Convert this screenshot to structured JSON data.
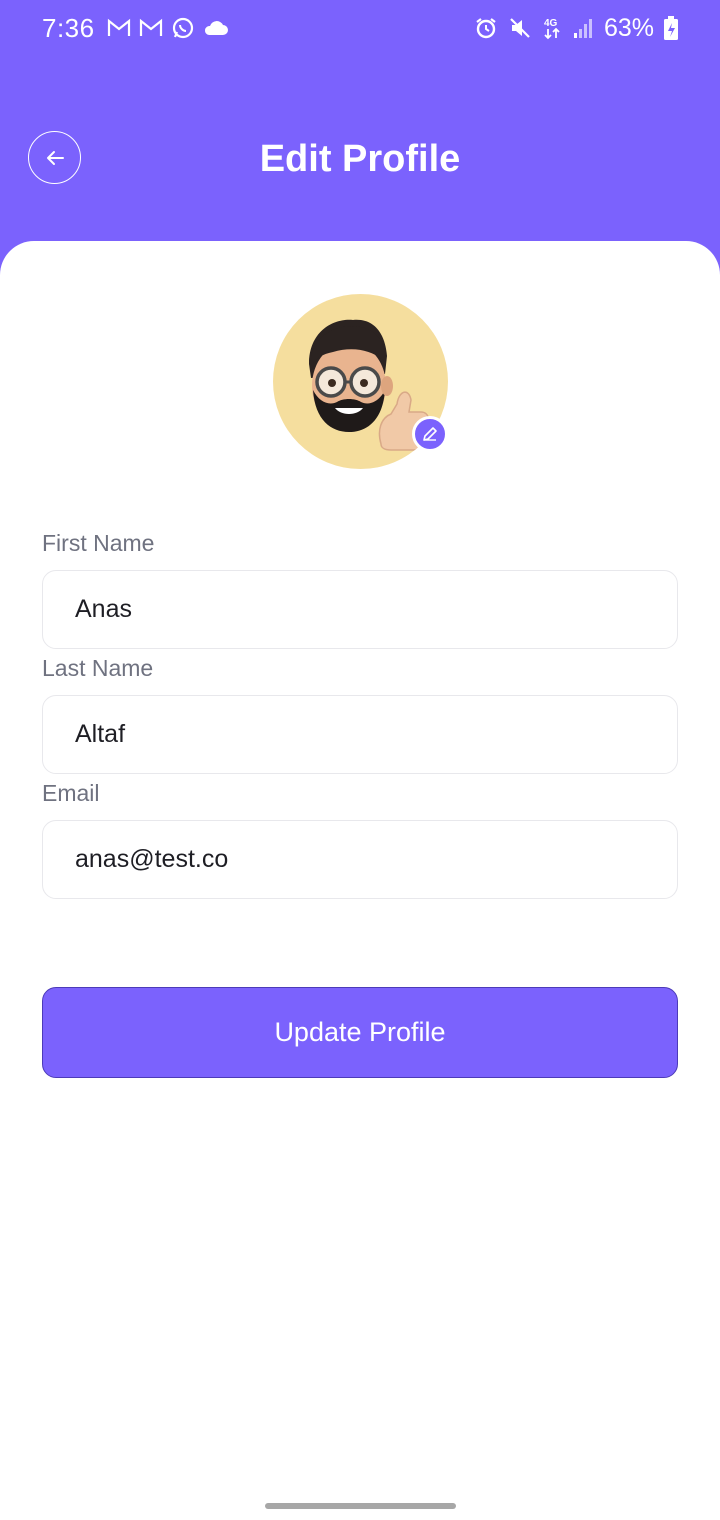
{
  "status_bar": {
    "time": "7:36",
    "battery": "63%",
    "left_icons": [
      "gmail-icon",
      "gmail-icon",
      "whatsapp-icon",
      "cloud-icon"
    ],
    "right_icons": [
      "alarm-icon",
      "vibrate-icon",
      "network-4g-icon",
      "signal-icon",
      "battery-icon"
    ]
  },
  "header": {
    "title": "Edit Profile",
    "back_icon": "arrow-left-icon"
  },
  "profile": {
    "avatar_icon": "memoji-avatar",
    "edit_icon": "pencil-icon"
  },
  "form": {
    "first_name": {
      "label": "First Name",
      "value": "Anas"
    },
    "last_name": {
      "label": "Last Name",
      "value": "Altaf"
    },
    "email": {
      "label": "Email",
      "value": "anas@test.co"
    }
  },
  "actions": {
    "update_label": "Update Profile"
  },
  "colors": {
    "primary": "#7B62FD",
    "avatar_bg": "#F5DE9E",
    "label": "#6F7280"
  }
}
